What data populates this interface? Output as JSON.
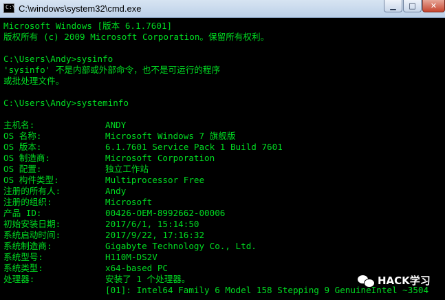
{
  "window": {
    "title": "C:\\windows\\system32\\cmd.exe",
    "icon": "cmd-icon",
    "min_label": "▁",
    "max_label": "□",
    "close_label": "✕"
  },
  "console": {
    "lines": [
      "Microsoft Windows [版本 6.1.7601]",
      "版权所有 (c) 2009 Microsoft Corporation。保留所有权利。",
      "",
      "C:\\Users\\Andy>sysinfo",
      "'sysinfo' 不是内部或外部命令，也不是可运行的程序",
      "或批处理文件。",
      "",
      "C:\\Users\\Andy>systeminfo",
      ""
    ],
    "info": [
      {
        "label": "主机名:",
        "value": "ANDY"
      },
      {
        "label": "OS 名称:",
        "value": "Microsoft Windows 7 旗舰版"
      },
      {
        "label": "OS 版本:",
        "value": "6.1.7601 Service Pack 1 Build 7601"
      },
      {
        "label": "OS 制造商:",
        "value": "Microsoft Corporation"
      },
      {
        "label": "OS 配置:",
        "value": "独立工作站"
      },
      {
        "label": "OS 构件类型:",
        "value": "Multiprocessor Free"
      },
      {
        "label": "注册的所有人:",
        "value": "Andy"
      },
      {
        "label": "注册的组织:",
        "value": "Microsoft"
      },
      {
        "label": "产品 ID:",
        "value": "00426-OEM-8992662-00006"
      },
      {
        "label": "初始安装日期:",
        "value": "2017/6/1, 15:14:50"
      },
      {
        "label": "系统启动时间:",
        "value": "2017/9/22, 17:16:32"
      },
      {
        "label": "系统制造商:",
        "value": "Gigabyte Technology Co., Ltd."
      },
      {
        "label": "系统型号:",
        "value": "H110M-DS2V"
      },
      {
        "label": "系统类型:",
        "value": "x64-based PC"
      },
      {
        "label": "处理器:",
        "value": "安装了 1 个处理器。"
      },
      {
        "label": "",
        "value": "[01]: Intel64 Family 6 Model 158 Stepping 9 GenuineIntel ~3504"
      }
    ]
  },
  "colors": {
    "console_text": "#00dd22",
    "console_bg": "#000000"
  },
  "watermark": {
    "text": "HACK学习",
    "icon": "wechat-icon"
  }
}
